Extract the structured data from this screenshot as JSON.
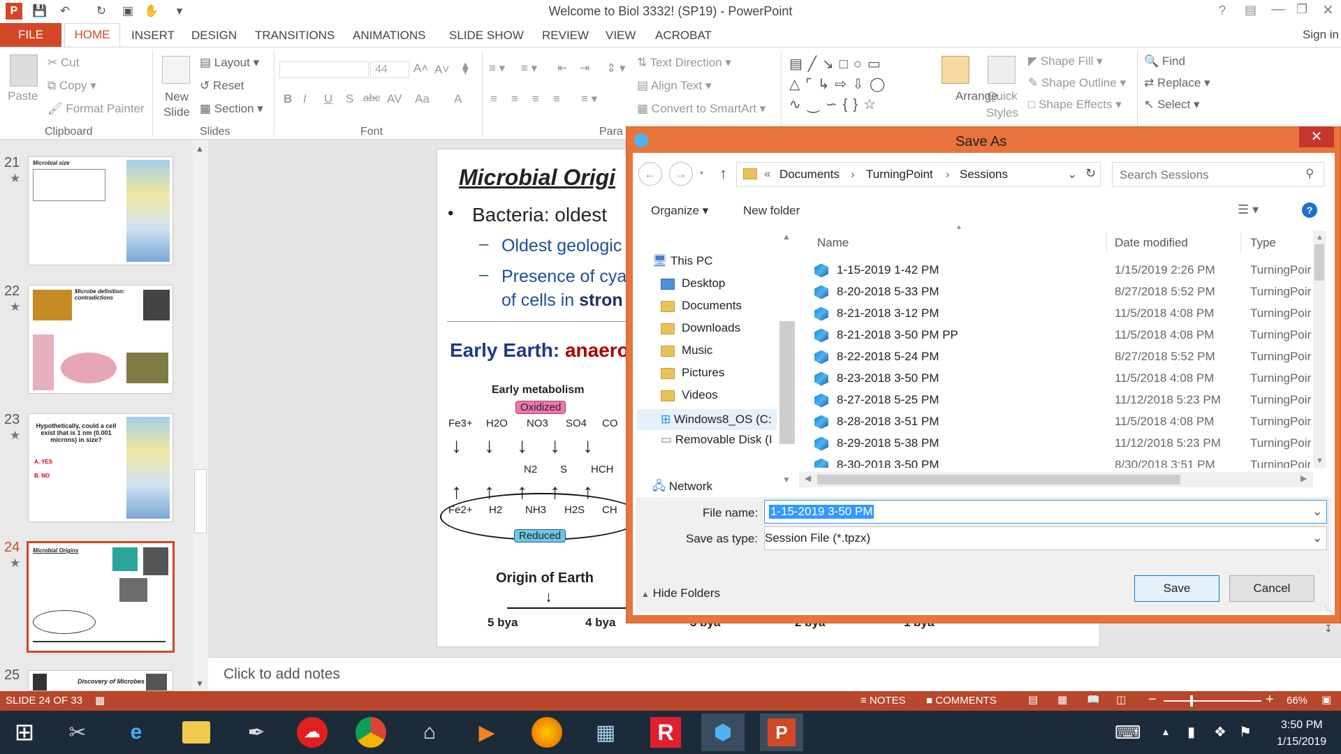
{
  "window": {
    "title": "Welcome to Biol 3332! (SP19) - PowerPoint",
    "sign_in": "Sign in",
    "help": "?"
  },
  "ribbon_tabs": [
    "FILE",
    "HOME",
    "INSERT",
    "DESIGN",
    "TRANSITIONS",
    "ANIMATIONS",
    "SLIDE SHOW",
    "REVIEW",
    "VIEW",
    "ACROBAT"
  ],
  "ribbon": {
    "clipboard": {
      "paste": "Paste",
      "cut": "Cut",
      "copy": "Copy",
      "format_painter": "Format Painter",
      "group": "Clipboard"
    },
    "slides": {
      "new_slide": "New Slide",
      "layout": "Layout",
      "reset": "Reset",
      "section": "Section",
      "group": "Slides"
    },
    "font": {
      "size": "44",
      "group": "Font",
      "bold": "B",
      "italic": "I",
      "underline": "U",
      "strike": "S",
      "shadow": "abc",
      "spacing": "AV",
      "case": "Aa",
      "color": "A"
    },
    "paragraph": {
      "text_direction": "Text Direction",
      "align_text": "Align Text",
      "convert": "Convert to SmartArt",
      "group": "Para"
    },
    "drawing": {
      "arrange": "Arrange",
      "quick_styles": "Quick Styles",
      "shape_fill": "Shape Fill",
      "shape_outline": "Shape Outline",
      "shape_effects": "Shape Effects"
    },
    "editing": {
      "find": "Find",
      "replace": "Replace",
      "select": "Select"
    }
  },
  "thumbnails": [
    {
      "num": "21",
      "title": "Microbial size"
    },
    {
      "num": "22",
      "title": "Microbe definition: contradictions"
    },
    {
      "num": "23",
      "title": "Hypothetically, could a cell exist that is 1 nm (0.001 microns) in size?",
      "a": "A. YES",
      "b": "B. NO"
    },
    {
      "num": "24",
      "title": "Microbial Origins"
    },
    {
      "num": "25",
      "title": "Discovery of Microbes"
    }
  ],
  "slide": {
    "title": "Microbial Origi",
    "bullet1": "Bacteria:  oldest",
    "sub1": "Oldest geologic",
    "sub2a": "Presence of cya",
    "sub2b_pre": "of cells in ",
    "sub2b_bold": "stron",
    "early_pre": "Early Earth: ",
    "early_red": "anaero",
    "metab_title": "Early metabolism",
    "oxidized": "Oxidized",
    "reduced": "Reduced",
    "ox": [
      "Fe3+",
      "H2O",
      "NO3",
      "SO4",
      "CO"
    ],
    "mid": [
      "N2",
      "S",
      "HCH"
    ],
    "red": [
      "Fe2+",
      "H2",
      "NH3",
      "H2S",
      "CH"
    ],
    "origin": "Origin of Earth",
    "ticks": [
      "5 bya",
      "4 bya",
      "3 bya",
      "2 bya",
      "1 bya"
    ]
  },
  "notes_placeholder": "Click to add notes",
  "status": {
    "slide": "SLIDE 24 OF 33",
    "notes": "NOTES",
    "comments": "COMMENTS",
    "zoom": "66%"
  },
  "dialog": {
    "title": "Save As",
    "breadcrumb": [
      "Documents",
      "TurningPoint",
      "Sessions"
    ],
    "search_placeholder": "Search Sessions",
    "organize": "Organize",
    "new_folder": "New folder",
    "nav": [
      "This PC",
      "Desktop",
      "Documents",
      "Downloads",
      "Music",
      "Pictures",
      "Videos",
      "Windows8_OS (C:",
      "Removable Disk (I",
      "Network"
    ],
    "columns": [
      "Name",
      "Date modified",
      "Type"
    ],
    "files": [
      {
        "name": "1-15-2019 1-42 PM",
        "date": "1/15/2019 2:26 PM",
        "type": "TurningPoir"
      },
      {
        "name": "8-20-2018 5-33 PM",
        "date": "8/27/2018 5:52 PM",
        "type": "TurningPoir"
      },
      {
        "name": "8-21-2018 3-12 PM",
        "date": "11/5/2018 4:08 PM",
        "type": "TurningPoir"
      },
      {
        "name": "8-21-2018 3-50 PM PP",
        "date": "11/5/2018 4:08 PM",
        "type": "TurningPoir"
      },
      {
        "name": "8-22-2018 5-24 PM",
        "date": "8/27/2018 5:52 PM",
        "type": "TurningPoir"
      },
      {
        "name": "8-23-2018 3-50 PM",
        "date": "11/5/2018 4:08 PM",
        "type": "TurningPoir"
      },
      {
        "name": "8-27-2018 5-25 PM",
        "date": "11/12/2018 5:23 PM",
        "type": "TurningPoir"
      },
      {
        "name": "8-28-2018 3-51 PM",
        "date": "11/5/2018 4:08 PM",
        "type": "TurningPoir"
      },
      {
        "name": "8-29-2018 5-38 PM",
        "date": "11/12/2018 5:23 PM",
        "type": "TurningPoir"
      },
      {
        "name": "8-30-2018 3-50 PM",
        "date": "8/30/2018 3:51 PM",
        "type": "TurningPoir"
      }
    ],
    "file_name_label": "File name:",
    "file_name_value": "1-15-2019 3-50 PM",
    "save_type_label": "Save as type:",
    "save_type_value": "Session File (*.tpzx)",
    "hide_folders": "Hide Folders",
    "save": "Save",
    "cancel": "Cancel"
  },
  "clock": {
    "time": "3:50 PM",
    "date": "1/15/2019"
  },
  "colors": {
    "accent": "#d24726",
    "status": "#b7472a",
    "dialog_frame": "#e8743b",
    "taskbar": "#1c2b3a",
    "selection": "#3399ff"
  }
}
